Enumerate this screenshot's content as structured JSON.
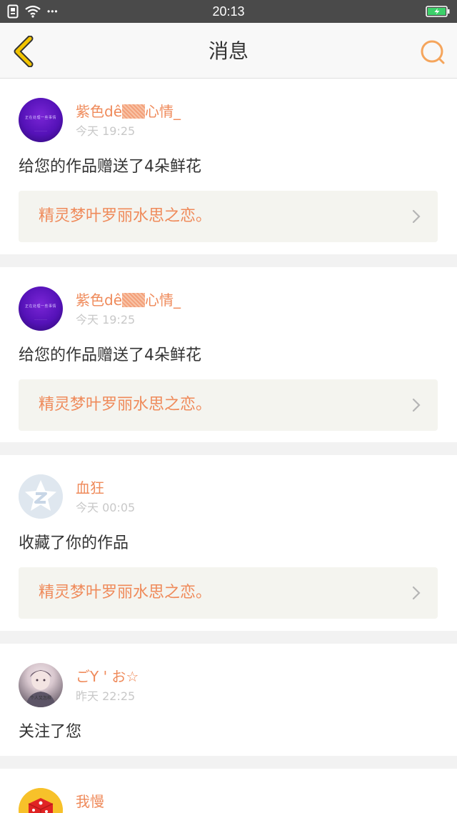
{
  "status_bar": {
    "time": "20:13",
    "dots": "•••"
  },
  "header": {
    "title": "消息"
  },
  "colors": {
    "accent": "#ef8a5a",
    "status_bar_bg": "#4a4a4a",
    "back_arrow": "#f2c400",
    "battery": "#3cd06a"
  },
  "messages": [
    {
      "user": "紫色dê",
      "user_suffix": "心情_",
      "time": "今天 19:25",
      "action": "给您的作品赠送了4朵鲜花",
      "work": "精灵梦叶罗丽水思之恋。",
      "avatar_icon": "purple-avatar"
    },
    {
      "user": "紫色dê",
      "user_suffix": "心情_",
      "time": "今天 19:25",
      "action": "给您的作品赠送了4朵鲜花",
      "work": "精灵梦叶罗丽水思之恋。",
      "avatar_icon": "purple-avatar"
    },
    {
      "user": "血狂",
      "time": "今天 00:05",
      "action": "收藏了你的作品",
      "work": "精灵梦叶罗丽水思之恋。",
      "avatar_icon": "qq-default-avatar"
    },
    {
      "user": "ごY ' お☆",
      "time": "昨天 22:25",
      "action": "关注了您",
      "avatar_icon": "photo-avatar"
    },
    {
      "user": "我慢",
      "avatar_icon": "dice-avatar"
    }
  ]
}
